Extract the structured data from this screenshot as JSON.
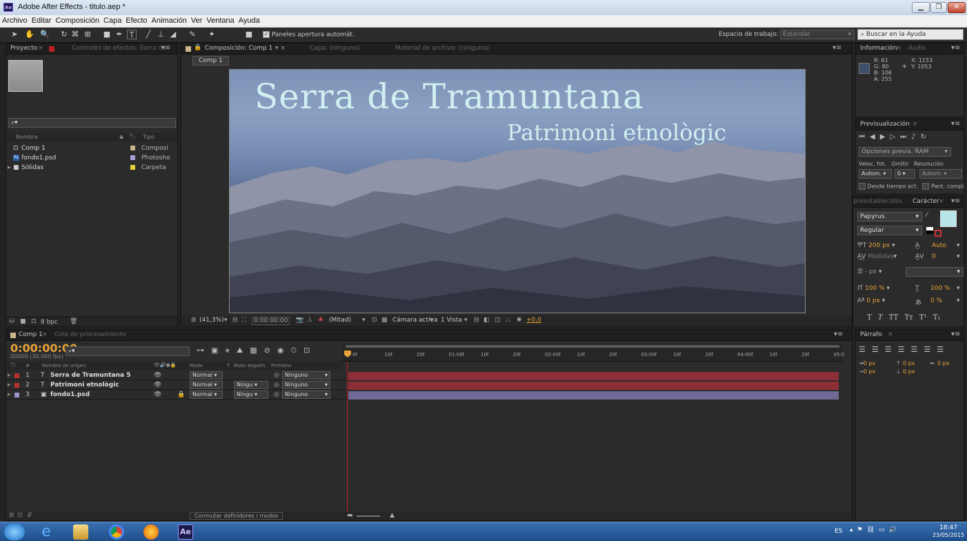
{
  "window": {
    "title": "Adobe After Effects - titulo.aep *",
    "app_badge": "Ae"
  },
  "menu": [
    "Archivo",
    "Editar",
    "Composición",
    "Capa",
    "Efecto",
    "Animación",
    "Ver",
    "Ventana",
    "Ayuda"
  ],
  "toolbar": {
    "auto_open_label": "Paneles apertura automát.",
    "workspace_label": "Espacio de trabajo:",
    "workspace_value": "Estándar",
    "help_search": "Buscar en la Ayuda"
  },
  "project_panel": {
    "tabs": [
      "Proyecto",
      "Controles de efectos: Serra de"
    ],
    "columns": [
      "Nombre",
      "Tipo"
    ],
    "items": [
      {
        "name": "Comp 1",
        "type": "Composi",
        "color": "#c9b98a"
      },
      {
        "name": "fondo1.psd",
        "type": "Photosho",
        "color": "#a9a3d8"
      },
      {
        "name": "Sólidas",
        "type": "Carpeta",
        "color": "#e8d53a"
      }
    ],
    "bpc": "8 bpc"
  },
  "comp_panel": {
    "tabs": [
      "Composición: Comp 1",
      "Capa: (ninguno)",
      "Material de archivo: (ninguno)"
    ],
    "breadcrumb": "Comp 1",
    "title_text": "Serra de Tramuntana",
    "subtitle_text": "Patrimoni etnològic",
    "zoom": "(41,3%)",
    "timecode": "0:00:00:00",
    "resolution": "(Mitad)",
    "camera": "Cámara activa",
    "views": "1 Vista",
    "exposure": "+0,0"
  },
  "info_panel": {
    "tabs": [
      "Información",
      "Audio"
    ],
    "r": "R: 61",
    "g": "G: 80",
    "b": "B: 106",
    "a": "A: 255",
    "x": "X: 1153",
    "y": "Y: 1053",
    "swatch": "#3d506a"
  },
  "preview_panel": {
    "tab": "Previsualización",
    "ram_options": "Opciones previs. RAM",
    "labels": [
      "Veloc. fot.",
      "Omitir",
      "Resolución"
    ],
    "values": [
      "Autom.",
      "0",
      "Autom."
    ],
    "from_current": "Desde tiempo act.",
    "fullscreen": "Pant. compl."
  },
  "character_panel": {
    "tabs": [
      "preestablecidos",
      "Carácter"
    ],
    "font": "Papyrus",
    "style": "Regular",
    "size": "200 px",
    "leading": "Auto",
    "kerning": "Medidas",
    "tracking": "0",
    "stroke": "- px",
    "vscale": "100 %",
    "hscale": "100 %",
    "baseline": "0 px",
    "tsume": "0 %",
    "fill_color": "#b8e6e8",
    "style_buttons": [
      "T",
      "T",
      "TT",
      "Tт",
      "T¹",
      "T₁"
    ]
  },
  "paragraph_panel": {
    "tab": "Párrafo",
    "values": [
      "0 px",
      "0 px",
      "0 px",
      "0 px",
      "0 px"
    ]
  },
  "timeline": {
    "tabs": [
      "Comp 1",
      "Cola de procesamiento"
    ],
    "timecode": "0:00:00:00",
    "fps": "00000 (30.000 fps)",
    "col_headers": [
      "#",
      "Nombre de origen",
      "Modo",
      "T",
      "Mate seguim.",
      "Primario"
    ],
    "layers": [
      {
        "num": "1",
        "name": "Serra de Tramuntana 5",
        "mode": "Normal",
        "matte": "",
        "parent": "Ninguno",
        "label": "#b83030",
        "bar": "#8e2f37"
      },
      {
        "num": "2",
        "name": "Patrimoni etnològic",
        "mode": "Normal",
        "matte": "Ningu",
        "parent": "Ninguno",
        "label": "#b83030",
        "bar": "#8e2f37"
      },
      {
        "num": "3",
        "name": "fondo1.psd",
        "mode": "Normal",
        "matte": "Ningu",
        "parent": "Ninguno",
        "label": "#9a96c8",
        "bar": "#6f6a95"
      }
    ],
    "ruler": [
      "0f",
      "10f",
      "20f",
      "01:00f",
      "10f",
      "20f",
      "02:00f",
      "10f",
      "20f",
      "03:00f",
      "10f",
      "20f",
      "04:00f",
      "10f",
      "20f",
      "05:0"
    ],
    "switch_label": "Conmutar definidores / modos"
  },
  "taskbar": {
    "lang": "ES",
    "time": "18:47",
    "date": "23/05/2015"
  }
}
